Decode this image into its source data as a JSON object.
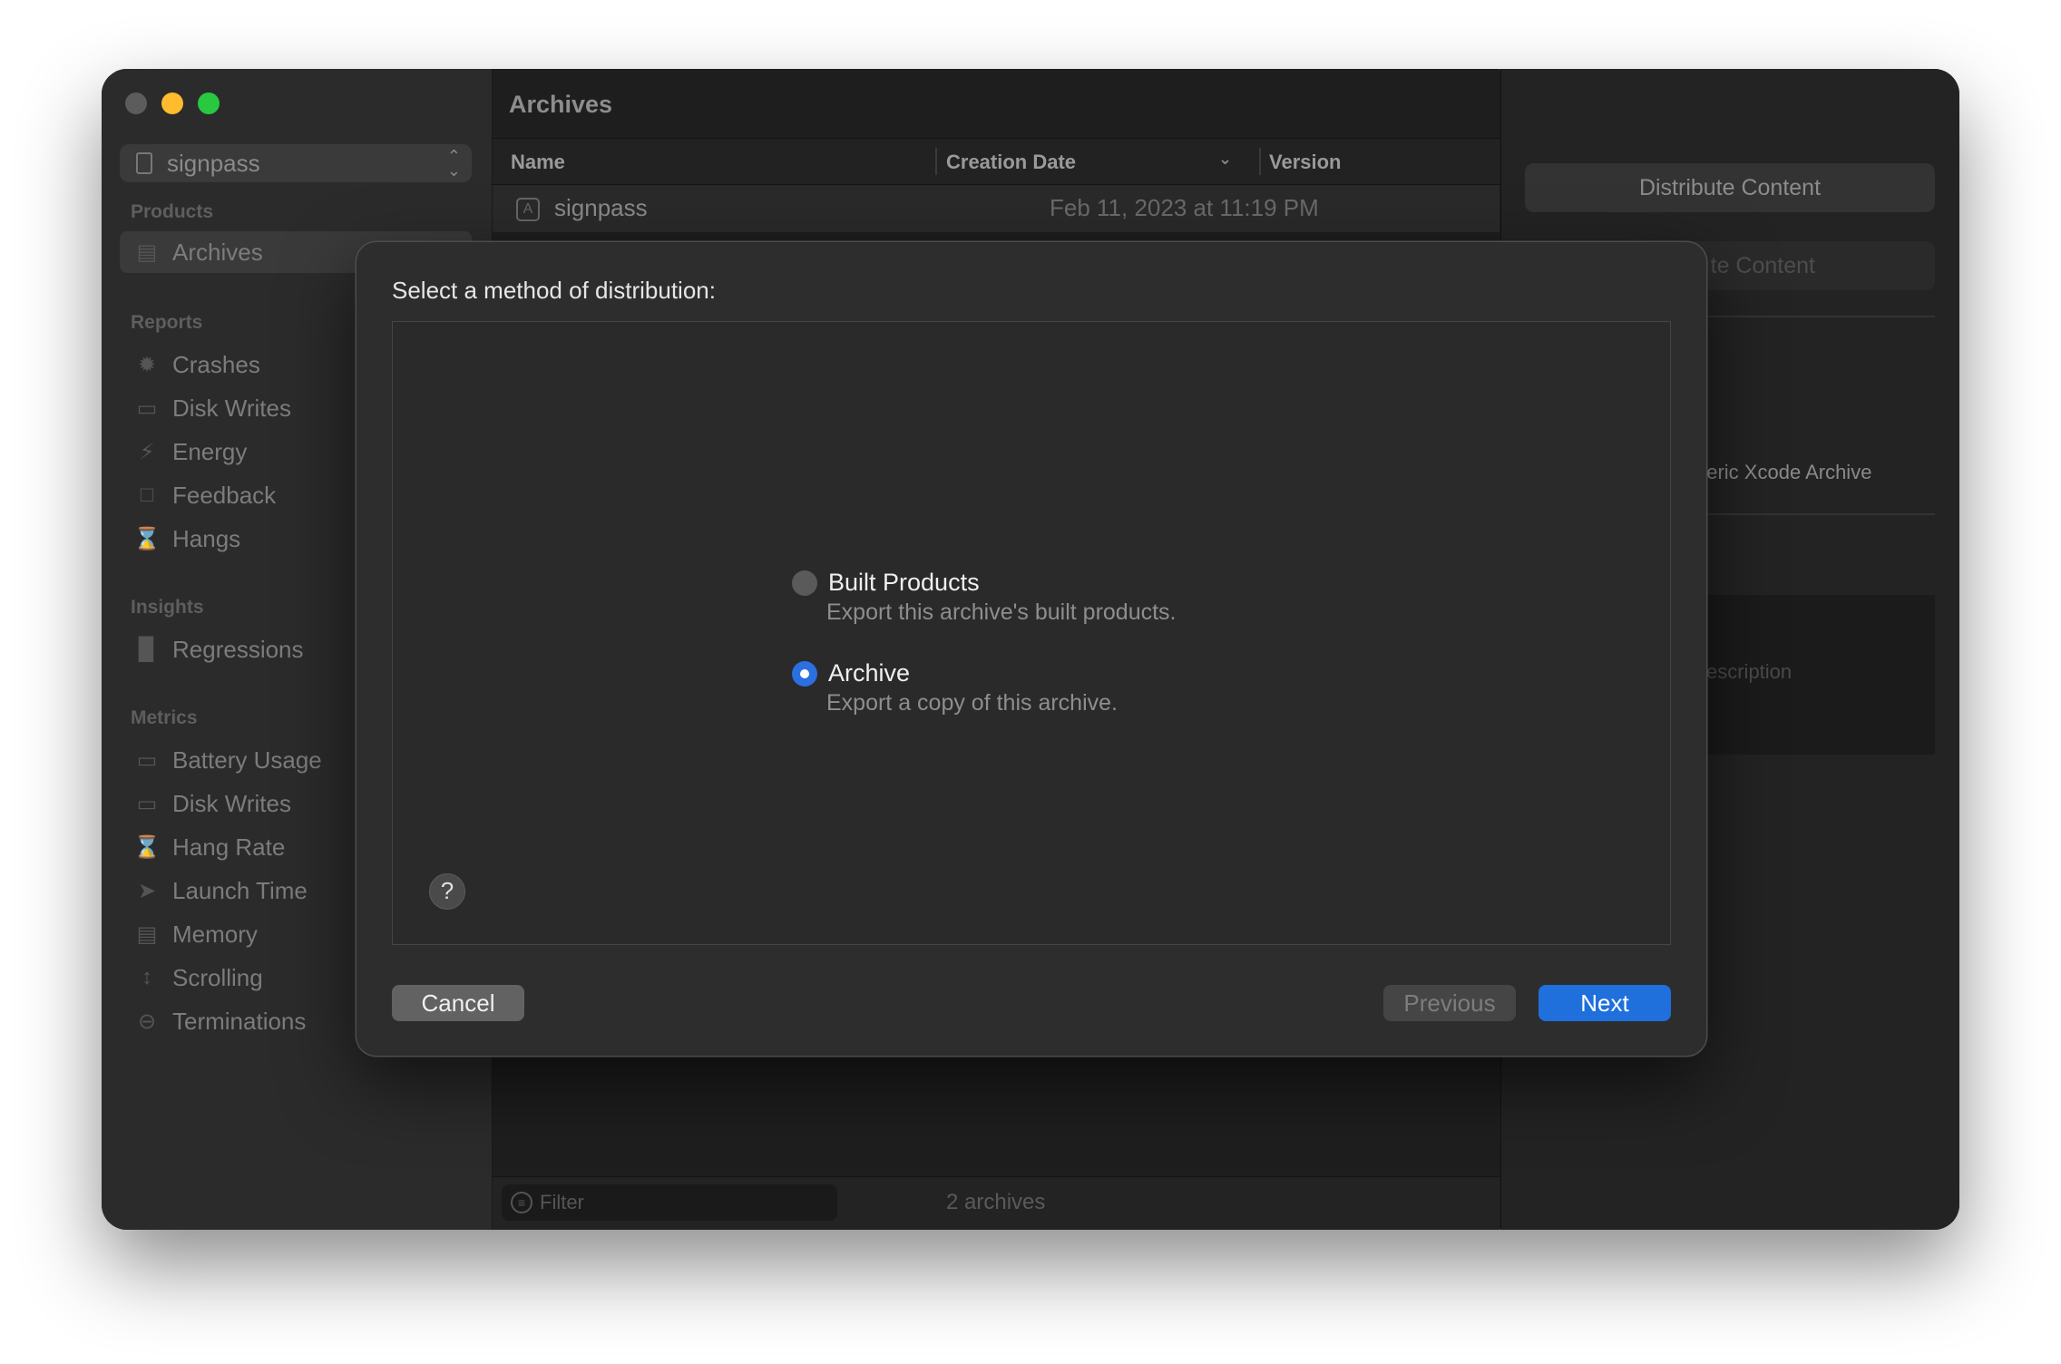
{
  "window": {
    "sidebar": {
      "scheme": "signpass",
      "sections": [
        {
          "header": "Products",
          "items": [
            "Archives"
          ]
        },
        {
          "header": "Reports",
          "items": [
            "Crashes",
            "Disk Writes",
            "Energy",
            "Feedback",
            "Hangs"
          ]
        },
        {
          "header": "Insights",
          "items": [
            "Regressions"
          ]
        },
        {
          "header": "Metrics",
          "items": [
            "Battery Usage",
            "Disk Writes",
            "Hang Rate",
            "Launch Time",
            "Memory",
            "Scrolling",
            "Terminations"
          ]
        }
      ]
    },
    "content": {
      "title": "Archives",
      "columns": [
        "Name",
        "Creation Date",
        "Version"
      ],
      "rows": [
        {
          "name": "signpass",
          "date": "Feb 11, 2023 at 11:19 PM",
          "version": ""
        }
      ],
      "filter_placeholder": "Filter",
      "count": "2 archives"
    },
    "inspector": {
      "distribute_button": "Distribute Content",
      "validate_button_partial": "te Content",
      "type_partial": "neric Xcode Archive",
      "description_partial": "escription"
    }
  },
  "sheet": {
    "title": "Select a method of distribution:",
    "options": [
      {
        "title": "Built Products",
        "description": "Export this archive's built products.",
        "selected": false
      },
      {
        "title": "Archive",
        "description": "Export a copy of this archive.",
        "selected": true
      }
    ],
    "help": "?",
    "cancel": "Cancel",
    "previous": "Previous",
    "next": "Next"
  }
}
